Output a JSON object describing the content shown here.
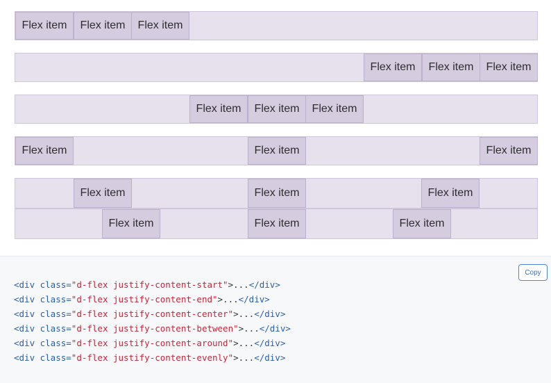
{
  "example": {
    "rows": [
      {
        "id": "start",
        "items": [
          "Flex item",
          "Flex item",
          "Flex item"
        ]
      },
      {
        "id": "end",
        "items": [
          "Flex item",
          "Flex item",
          "Flex item"
        ]
      },
      {
        "id": "center",
        "items": [
          "Flex item",
          "Flex item",
          "Flex item"
        ]
      },
      {
        "id": "between",
        "items": [
          "Flex item",
          "Flex item",
          "Flex item"
        ]
      },
      {
        "id": "around",
        "items": [
          "Flex item",
          "Flex item",
          "Flex item"
        ]
      },
      {
        "id": "evenly",
        "items": [
          "Flex item",
          "Flex item",
          "Flex item"
        ]
      }
    ]
  },
  "code": {
    "copy_label": "Copy",
    "lines": [
      {
        "open": "<div",
        "attr": " class=",
        "value": "\"d-flex justify-content-start\"",
        "rest": ">...",
        "close": "</div>"
      },
      {
        "open": "<div",
        "attr": " class=",
        "value": "\"d-flex justify-content-end\"",
        "rest": ">...",
        "close": "</div>"
      },
      {
        "open": "<div",
        "attr": " class=",
        "value": "\"d-flex justify-content-center\"",
        "rest": ">...",
        "close": "</div>"
      },
      {
        "open": "<div",
        "attr": " class=",
        "value": "\"d-flex justify-content-between\"",
        "rest": ">...",
        "close": "</div>"
      },
      {
        "open": "<div",
        "attr": " class=",
        "value": "\"d-flex justify-content-around\"",
        "rest": ">...",
        "close": "</div>"
      },
      {
        "open": "<div",
        "attr": " class=",
        "value": "\"d-flex justify-content-evenly\"",
        "rest": ">...",
        "close": "</div>"
      }
    ]
  },
  "colors": {
    "row_bg": "#e6e1ec",
    "item_bg": "#d6cce0",
    "code_string": "#c3263a",
    "code_tag": "#2a5fa5",
    "copy_border": "#4f87d1"
  }
}
